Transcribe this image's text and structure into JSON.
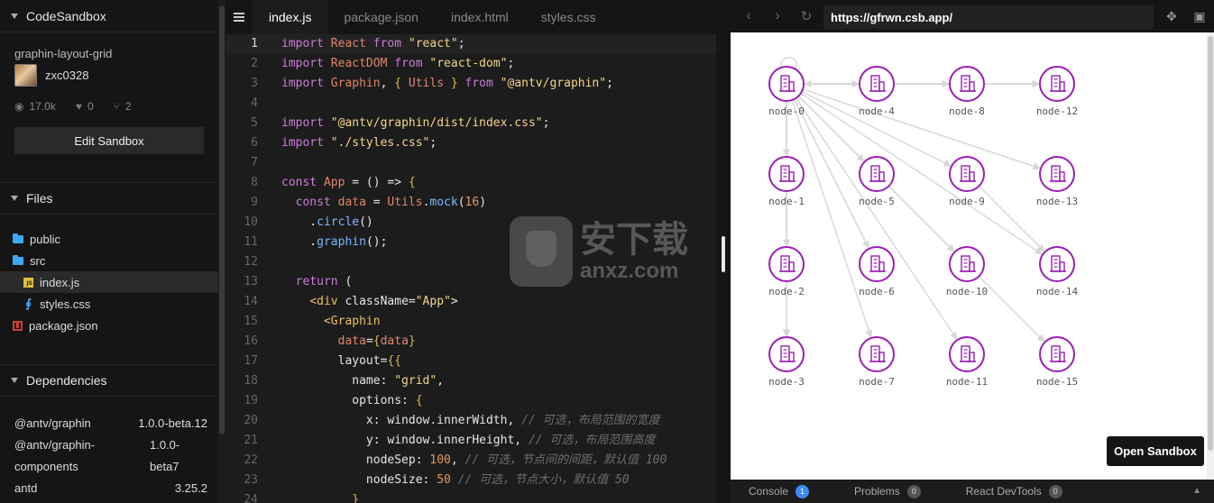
{
  "sidebar": {
    "app_title": "CodeSandbox",
    "sandbox_name": "graphin-layout-grid",
    "username": "zxc0328",
    "stats": {
      "views": "17.0k",
      "likes": "0",
      "forks": "2"
    },
    "edit_button": "Edit Sandbox",
    "files_header": "Files",
    "files": [
      {
        "name": "public",
        "type": "folder"
      },
      {
        "name": "src",
        "type": "folder"
      },
      {
        "name": "index.js",
        "type": "js",
        "active": true
      },
      {
        "name": "styles.css",
        "type": "css"
      },
      {
        "name": "package.json",
        "type": "json"
      }
    ],
    "dependencies_header": "Dependencies",
    "dependencies": [
      {
        "name": "@antv/graphin",
        "version": "1.0.0-beta.12"
      },
      {
        "name": "@antv/graphin-components",
        "version": "1.0.0-beta7"
      },
      {
        "name": "antd",
        "version": "3.25.2"
      }
    ]
  },
  "editor": {
    "tabs": [
      "index.js",
      "package.json",
      "index.html",
      "styles.css"
    ],
    "active_tab": "index.js",
    "line_numbers": [
      "1",
      "2",
      "3",
      "4",
      "5",
      "6",
      "7",
      "8",
      "9",
      "10",
      "11",
      "12",
      "13",
      "14",
      "15",
      "16",
      "17",
      "18",
      "19",
      "20",
      "21",
      "22",
      "23",
      "24"
    ],
    "lines": [
      "import React from \"react\";",
      "import ReactDOM from \"react-dom\";",
      "import Graphin, { Utils } from \"@antv/graphin\";",
      "",
      "import \"@antv/graphin/dist/index.css\";",
      "import \"./styles.css\";",
      "",
      "const App = () => {",
      "  const data = Utils.mock(16)",
      "    .circle()",
      "    .graphin();",
      "",
      "  return (",
      "    <div className=\"App\">",
      "      <Graphin",
      "        data={data}",
      "        layout={{",
      "          name: \"grid\",",
      "          options: {",
      "            x: window.innerWidth, // 可选，布局范围的宽度",
      "            y: window.innerHeight, // 可选，布局范围高度",
      "            nodeSep: 100, // 可选，节点间的间距，默认值 100",
      "            nodeSize: 50 // 可选，节点大小，默认值 50",
      "          }"
    ]
  },
  "preview": {
    "url": "https://gfrwn.csb.app/",
    "open_button": "Open Sandbox",
    "node_color": "#9a1fb5",
    "edge_color": "#d6d6d6",
    "nodes": [
      "node-0",
      "node-1",
      "node-2",
      "node-3",
      "node-4",
      "node-5",
      "node-6",
      "node-7",
      "node-8",
      "node-9",
      "node-10",
      "node-11",
      "node-12",
      "node-13",
      "node-14",
      "node-15"
    ],
    "devtools": [
      {
        "label": "Console",
        "count": "1"
      },
      {
        "label": "Problems",
        "count": "0"
      },
      {
        "label": "React DevTools",
        "count": "0"
      }
    ]
  },
  "watermark": {
    "cn": "安下载",
    "en": "anxz.com"
  }
}
